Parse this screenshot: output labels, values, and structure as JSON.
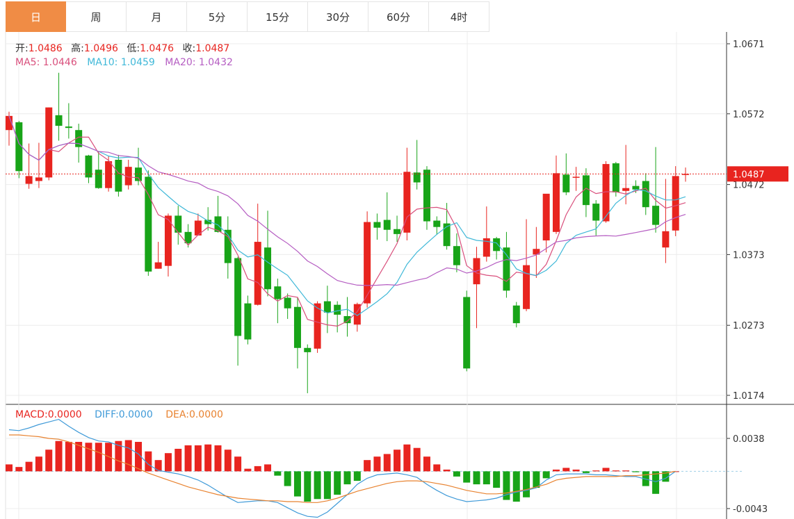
{
  "tabs": [
    "日",
    "周",
    "月",
    "5分",
    "15分",
    "30分",
    "60分",
    "4时"
  ],
  "active_tab": 0,
  "ohlc_legend": {
    "open_label": "开:",
    "open": "1.0486",
    "high_label": "高:",
    "high": "1.0496",
    "low_label": "低:",
    "low": "1.0476",
    "close_label": "收:",
    "close": "1.0487"
  },
  "ma_legend": {
    "ma5_label": "MA5:",
    "ma5": "1.0446",
    "ma10_label": "MA10:",
    "ma10": "1.0459",
    "ma20_label": "MA20:",
    "ma20": "1.0432"
  },
  "macd_legend": {
    "macd_label": "MACD:",
    "macd": "0.0000",
    "diff_label": "DIFF:",
    "diff": "0.0000",
    "dea_label": "DEA:",
    "dea": "0.0000"
  },
  "current_price": "1.0487",
  "colors": {
    "up": "#e8241f",
    "down": "#18a418",
    "accent": "#f08c45",
    "ma5": "#d94f7c",
    "ma10": "#3fb8d8",
    "ma20": "#b55dc2",
    "diff": "#3f9ad8",
    "dea": "#e8822f",
    "price_line": "#e8241f"
  },
  "chart_data": [
    {
      "type": "candlestick",
      "y_ticks": [
        "1.0671",
        "1.0572",
        "1.0472",
        "1.0373",
        "1.0273",
        "1.0174"
      ],
      "ylim": [
        1.0174,
        1.0671
      ],
      "candles": [
        [
          1.0549,
          1.0569,
          1.0527,
          1.0575
        ],
        [
          1.056,
          1.0491,
          1.0481,
          1.0562
        ],
        [
          1.0473,
          1.0484,
          1.0466,
          1.053
        ],
        [
          1.0477,
          1.0482,
          1.0467,
          1.0531
        ],
        [
          1.0482,
          1.0581,
          1.0478,
          1.0581
        ],
        [
          1.057,
          1.0555,
          1.0534,
          1.063
        ],
        [
          1.0554,
          1.0552,
          1.0537,
          1.0587
        ],
        [
          1.0549,
          1.0525,
          1.0503,
          1.0558
        ],
        [
          1.0513,
          1.0482,
          1.0474,
          1.0514
        ],
        [
          1.0493,
          1.0467,
          1.0466,
          1.0519
        ],
        [
          1.0467,
          1.0505,
          1.0462,
          1.0512
        ],
        [
          1.0507,
          1.0462,
          1.0455,
          1.0514
        ],
        [
          1.0471,
          1.0497,
          1.0465,
          1.0507
        ],
        [
          1.0496,
          1.0477,
          1.0471,
          1.0524
        ],
        [
          1.0483,
          1.0349,
          1.0343,
          1.0492
        ],
        [
          1.0353,
          1.0362,
          1.0353,
          1.0391
        ],
        [
          1.0357,
          1.0428,
          1.0342,
          1.0431
        ],
        [
          1.0428,
          1.0404,
          1.0387,
          1.0442
        ],
        [
          1.0405,
          1.0389,
          1.0383,
          1.0416
        ],
        [
          1.04,
          1.0421,
          1.04,
          1.0431
        ],
        [
          1.0422,
          1.0416,
          1.0407,
          1.044
        ],
        [
          1.0427,
          1.0405,
          1.0404,
          1.0456
        ],
        [
          1.0408,
          1.0361,
          1.0339,
          1.0427
        ],
        [
          1.0368,
          1.0258,
          1.0216,
          1.037
        ],
        [
          1.0304,
          1.0253,
          1.0246,
          1.0315
        ],
        [
          1.0302,
          1.0391,
          1.0301,
          1.0445
        ],
        [
          1.0383,
          1.0324,
          1.0314,
          1.0435
        ],
        [
          1.0328,
          1.031,
          1.0276,
          1.0339
        ],
        [
          1.0312,
          1.0297,
          1.0282,
          1.0318
        ],
        [
          1.0299,
          1.0241,
          1.0212,
          1.0313
        ],
        [
          1.0241,
          1.0235,
          1.0177,
          1.0246
        ],
        [
          1.024,
          1.0304,
          1.0234,
          1.0307
        ],
        [
          1.0307,
          1.0291,
          1.0262,
          1.0329
        ],
        [
          1.0302,
          1.0288,
          1.0263,
          1.0307
        ],
        [
          1.0286,
          1.0276,
          1.0257,
          1.0313
        ],
        [
          1.0274,
          1.0303,
          1.0264,
          1.0305
        ],
        [
          1.0304,
          1.0419,
          1.0298,
          1.0434
        ],
        [
          1.0419,
          1.0411,
          1.0394,
          1.0431
        ],
        [
          1.0422,
          1.0408,
          1.0392,
          1.0461
        ],
        [
          1.0409,
          1.0402,
          1.0391,
          1.0428
        ],
        [
          1.0404,
          1.049,
          1.0393,
          1.0524
        ],
        [
          1.0489,
          1.0475,
          1.0465,
          1.0535
        ],
        [
          1.0493,
          1.042,
          1.0408,
          1.0498
        ],
        [
          1.0421,
          1.0412,
          1.0401,
          1.0427
        ],
        [
          1.0417,
          1.0385,
          1.038,
          1.0446
        ],
        [
          1.0385,
          1.0358,
          1.0348,
          1.0403
        ],
        [
          1.0313,
          1.0212,
          1.0208,
          1.0322
        ],
        [
          1.0331,
          1.0368,
          1.0269,
          1.0384
        ],
        [
          1.037,
          1.0396,
          1.0363,
          1.0441
        ],
        [
          1.0396,
          1.0378,
          1.0366,
          1.0398
        ],
        [
          1.0383,
          1.0322,
          1.0312,
          1.0405
        ],
        [
          1.0301,
          1.0276,
          1.027,
          1.0306
        ],
        [
          1.0296,
          1.0358,
          1.0293,
          1.0423
        ],
        [
          1.0373,
          1.0381,
          1.034,
          1.0412
        ],
        [
          1.0393,
          1.0459,
          1.0376,
          1.0455
        ],
        [
          1.0405,
          1.0488,
          1.0402,
          1.0513
        ],
        [
          1.0486,
          1.0461,
          1.0457,
          1.0516
        ],
        [
          1.0482,
          1.0483,
          1.0463,
          1.0497
        ],
        [
          1.0485,
          1.0443,
          1.0426,
          1.0495
        ],
        [
          1.0445,
          1.0421,
          1.04,
          1.045
        ],
        [
          1.042,
          1.0501,
          1.0418,
          1.0505
        ],
        [
          1.0502,
          1.0461,
          1.0455,
          1.0504
        ],
        [
          1.0463,
          1.0467,
          1.0444,
          1.0528
        ],
        [
          1.047,
          1.0465,
          1.046,
          1.0478
        ],
        [
          1.0477,
          1.044,
          1.0429,
          1.0488
        ],
        [
          1.0442,
          1.0415,
          1.0404,
          1.0525
        ],
        [
          1.0383,
          1.0406,
          1.0361,
          1.048
        ],
        [
          1.0407,
          1.0484,
          1.0399,
          1.0498
        ],
        [
          1.0486,
          1.0487,
          1.0476,
          1.0496
        ]
      ]
    },
    {
      "type": "bar",
      "title": "MACD",
      "y_ticks": [
        "0.0038",
        "-0.0043"
      ],
      "ylim": [
        -0.0043,
        0.0038
      ],
      "macd_hist": [
        0.0008,
        0.0005,
        0.0011,
        0.0017,
        0.0025,
        0.0035,
        0.0034,
        0.0034,
        0.0033,
        0.0033,
        0.0033,
        0.0035,
        0.0036,
        0.0034,
        0.0023,
        0.0013,
        0.0021,
        0.0026,
        0.003,
        0.003,
        0.0031,
        0.003,
        0.0025,
        0.0017,
        0.0003,
        0.0006,
        0.0008,
        -0.0005,
        -0.0017,
        -0.0029,
        -0.0035,
        -0.0032,
        -0.0032,
        -0.0027,
        -0.0015,
        -0.0011,
        0.0013,
        0.0017,
        0.002,
        0.0025,
        0.0031,
        0.0027,
        0.0017,
        0.0008,
        0.0002,
        -0.0006,
        -0.0013,
        -0.0015,
        -0.0015,
        -0.0019,
        -0.0033,
        -0.0035,
        -0.003,
        -0.0019,
        -0.0008,
        0.0002,
        0.0004,
        0.0002,
        -0.0002,
        0.0001,
        0.0004,
        0.0001,
        0.0001,
        -0.0001,
        -0.0017,
        -0.0026,
        -0.0012,
        0.0
      ],
      "diff": [
        0.0048,
        0.0047,
        0.005,
        0.0054,
        0.0057,
        0.006,
        0.0052,
        0.0045,
        0.0039,
        0.0035,
        0.0034,
        0.003,
        0.0027,
        0.002,
        0.0008,
        0.0001,
        -0.0001,
        -0.0003,
        -0.0006,
        -0.001,
        -0.0016,
        -0.0023,
        -0.003,
        -0.0036,
        -0.0035,
        -0.0034,
        -0.0034,
        -0.0036,
        -0.0042,
        -0.0048,
        -0.0052,
        -0.0053,
        -0.0047,
        -0.0037,
        -0.0027,
        -0.0015,
        -0.0008,
        -0.0004,
        -0.0003,
        -0.0002,
        -0.0004,
        -0.0007,
        -0.0015,
        -0.0022,
        -0.0028,
        -0.0032,
        -0.0035,
        -0.0034,
        -0.0033,
        -0.0031,
        -0.0027,
        -0.0024,
        -0.0022,
        -0.0019,
        -0.001,
        -0.0004,
        -0.0003,
        -0.0003,
        -0.0003,
        -0.0004,
        -0.0004,
        -0.0005,
        -0.0006,
        -0.0006,
        -0.0009,
        -0.0012,
        -0.0008,
        0.0
      ],
      "dea": [
        0.0042,
        0.0042,
        0.0041,
        0.004,
        0.0038,
        0.0037,
        0.0034,
        0.003,
        0.0026,
        0.0022,
        0.0017,
        0.0012,
        0.0008,
        0.0003,
        -0.0002,
        -0.0006,
        -0.001,
        -0.0014,
        -0.0018,
        -0.0021,
        -0.0024,
        -0.0027,
        -0.0029,
        -0.0031,
        -0.0032,
        -0.0033,
        -0.0034,
        -0.0034,
        -0.0035,
        -0.0035,
        -0.0036,
        -0.0036,
        -0.0034,
        -0.0031,
        -0.0027,
        -0.0023,
        -0.002,
        -0.0017,
        -0.0014,
        -0.0012,
        -0.0011,
        -0.0011,
        -0.0012,
        -0.0014,
        -0.0016,
        -0.0019,
        -0.0022,
        -0.0024,
        -0.0026,
        -0.0026,
        -0.0025,
        -0.0023,
        -0.0021,
        -0.0018,
        -0.0015,
        -0.001,
        -0.0008,
        -0.0007,
        -0.0006,
        -0.0006,
        -0.0006,
        -0.0006,
        -0.0005,
        -0.0005,
        -0.0004,
        -0.0003,
        -0.0002,
        0.0
      ]
    }
  ]
}
